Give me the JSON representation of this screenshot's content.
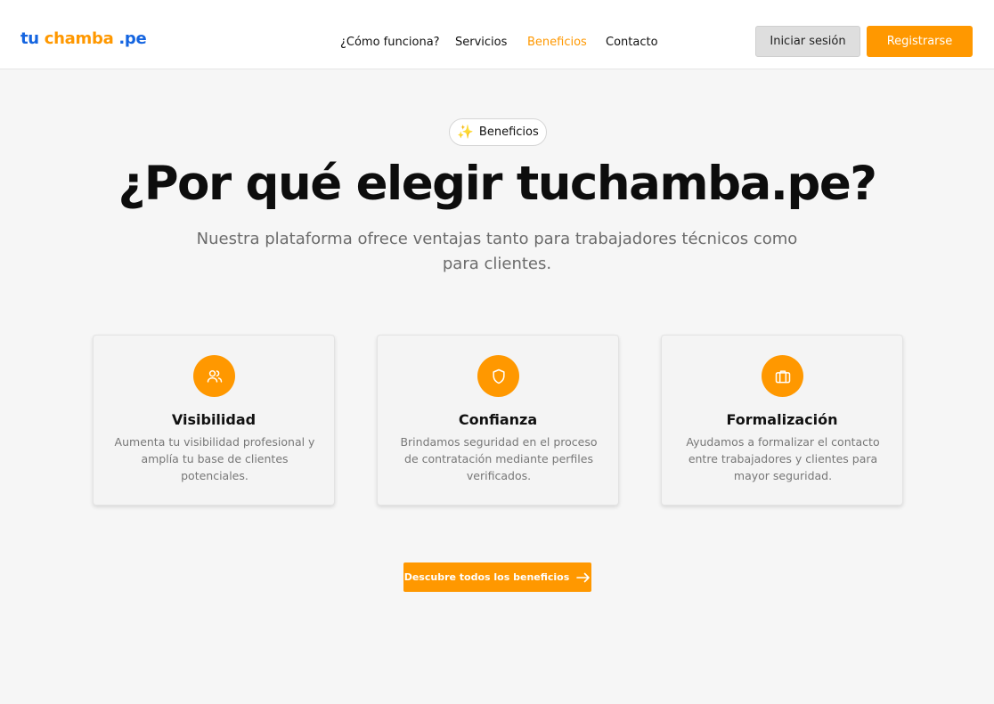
{
  "header": {
    "logo": {
      "part1": "tu",
      "part2": "chamba",
      "part3": ".pe"
    },
    "nav": [
      {
        "label": "¿Cómo funciona?"
      },
      {
        "label": "Servicios"
      },
      {
        "label": "Beneficios"
      },
      {
        "label": "Contacto"
      }
    ],
    "active_nav": "Beneficios",
    "login_label": "Iniciar sesión",
    "register_label": "Registrarse"
  },
  "hero": {
    "badge_icon": "sparkles-icon",
    "badge_label": "Beneficios",
    "title": "¿Por qué elegir tuchamba.pe?",
    "subtitle": "Nuestra plataforma ofrece ventajas tanto para trabajadores técnicos como para clientes."
  },
  "cards": [
    {
      "icon": "users-icon",
      "title": "Visibilidad",
      "text": "Aumenta tu visibilidad profesional y amplía tu base de clientes potenciales."
    },
    {
      "icon": "shield-icon",
      "title": "Confianza",
      "text": "Brindamos seguridad en el proceso de contratación mediante perfiles verificados."
    },
    {
      "icon": "briefcase-icon",
      "title": "Formalización",
      "text": "Ayudamos a formalizar el contacto entre trabajadores y clientes para mayor seguridad."
    }
  ],
  "cta": {
    "label": "Descubre todos los beneficios",
    "icon": "arrow-right-icon"
  },
  "colors": {
    "accent": "#ff9800",
    "brand_blue": "#1565e0",
    "background": "#f6f6f6"
  }
}
